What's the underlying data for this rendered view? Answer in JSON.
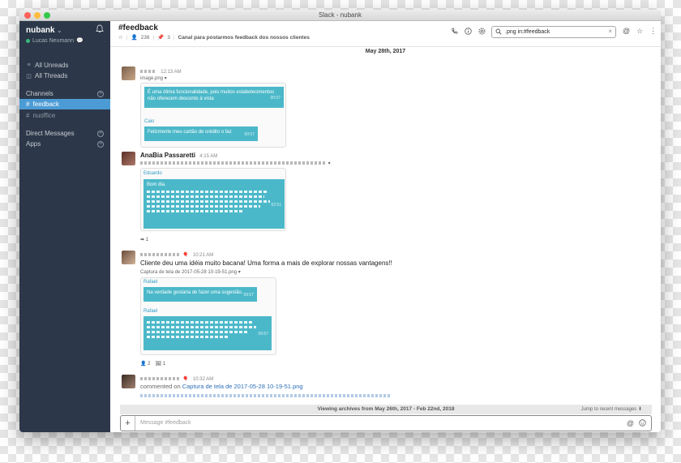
{
  "window": {
    "title": "Slack - nubank"
  },
  "sidebar": {
    "workspace": "nubank",
    "user": "Lucas Neumann",
    "nav": [
      {
        "label": "All Unreads"
      },
      {
        "label": "All Threads"
      }
    ],
    "channels_heading": "Channels",
    "channels": [
      {
        "label": "feedback",
        "active": true
      },
      {
        "label": "nuoffice",
        "active": false
      }
    ],
    "dm_heading": "Direct Messages",
    "apps_heading": "Apps"
  },
  "header": {
    "channel": "#feedback",
    "members": "236",
    "pins": "3",
    "purpose": "Canal para postarmos feedback dos nossos clientes",
    "search_value": ".png in:#feedback",
    "date": "May 28th, 2017"
  },
  "messages": [
    {
      "time": "12:13 AM",
      "file": "image.png",
      "bubble1_text": "É uma ótima funcionalidade, pois muitos estabelecimentos não oferecem desconto à vista",
      "bubble1_time": "00:07",
      "sender2": "Caio",
      "bubble2_text": "Felizmente meu cartão de crédito o faz",
      "bubble2_time": "00:07"
    },
    {
      "name": "AnaBia Passaretti",
      "time": "4:15 AM",
      "att_name": "Eduardo",
      "bubble_first": "Bom dia.",
      "bubble_time": "02:51",
      "reaction_count": "1"
    },
    {
      "time": "10:21 AM",
      "text": "Cliente deu uma idéia muito bacana! Uma forma a mais de explorar nossas vantagens!!",
      "file": "Captura de tela de 2017-05-28 10-19-51.png",
      "sender1": "Rafael",
      "bubble1_text": "Na verdade gostaria de fazer uma sugestão.",
      "bubble1_time": "09:57",
      "sender2": "Rafael",
      "bubble2_time": "09:57",
      "reaction1": "2",
      "reaction2": "1"
    },
    {
      "time": "10:32 AM",
      "comment_prefix": "commented on",
      "comment_link": "Captura de tela de 2017-05-28 10-19-51.png"
    }
  ],
  "footer": {
    "archive_text": "Viewing archives from May 26th, 2017 - Feb 22nd, 2018",
    "jump_text": "Jump to recent messages",
    "composer_placeholder": "Message #feedback"
  },
  "colors": {
    "sidebar": "#2c3849",
    "active_channel": "#4c9bd5",
    "bubble": "#4bb8c9"
  }
}
